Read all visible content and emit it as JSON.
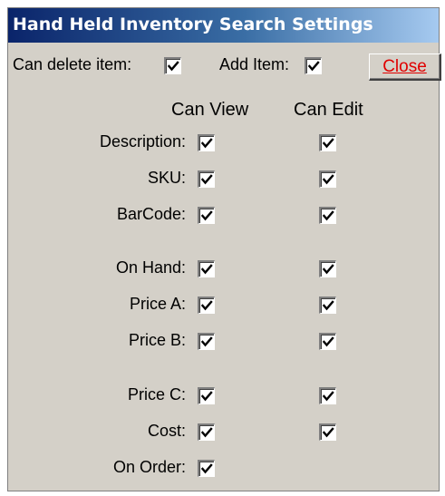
{
  "window": {
    "title": "Hand Held Inventory Search Settings"
  },
  "top_row": {
    "can_delete_label": "Can delete item:",
    "can_delete_checked": true,
    "add_item_label": "Add Item:",
    "add_item_checked": true,
    "close_label": "Close"
  },
  "columns": {
    "can_view": "Can View",
    "can_edit": "Can Edit"
  },
  "fields": [
    {
      "label": "Description:",
      "view": true,
      "edit": true
    },
    {
      "label": "SKU:",
      "view": true,
      "edit": true
    },
    {
      "label": "BarCode:",
      "view": true,
      "edit": true
    },
    {
      "label": "On Hand:",
      "view": true,
      "edit": true
    },
    {
      "label": "Price A:",
      "view": true,
      "edit": true
    },
    {
      "label": "Price B:",
      "view": true,
      "edit": true
    },
    {
      "label": "Price C:",
      "view": true,
      "edit": true
    },
    {
      "label": "Cost:",
      "view": true,
      "edit": true
    },
    {
      "label": "On Order:",
      "view": true
    }
  ],
  "colors": {
    "title_gradient_start": "#0a246a",
    "title_gradient_end": "#a6caf0",
    "window_background": "#d4d0c8",
    "close_text": "#e00000"
  }
}
